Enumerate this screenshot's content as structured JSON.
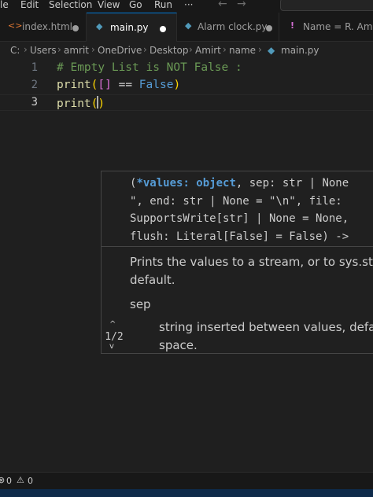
{
  "menubar": {
    "items": [
      "le",
      "Edit",
      "Selection",
      "View",
      "Go",
      "Run",
      "···"
    ],
    "back_arrow": "←",
    "forward_arrow": "→"
  },
  "tabs": [
    {
      "icon": "html-file-icon",
      "glyph": "<>",
      "label": "index.html",
      "modified": true,
      "active": false
    },
    {
      "icon": "python-file-icon",
      "glyph": "◆",
      "label": "main.py",
      "modified": true,
      "active": true
    },
    {
      "icon": "python-file-icon",
      "glyph": "◆",
      "label": "Alarm clock.py",
      "modified": true,
      "active": false
    },
    {
      "icon": "warning-icon",
      "glyph": "!",
      "label": "Name = R. Amrit",
      "modified": false,
      "active": false
    }
  ],
  "breadcrumb": [
    "C:",
    "Users",
    "amrit",
    "OneDrive",
    "Desktop",
    "Amirt",
    "name",
    "main.py"
  ],
  "editor": {
    "line_numbers": [
      "1",
      "2",
      "3"
    ],
    "line1": "# Empty List is NOT False :",
    "line2": {
      "func": "print",
      "open": "(",
      "list": "[]",
      "op": " == ",
      "kw": "False",
      "close": ")"
    },
    "line3": {
      "func": "print",
      "open": "(",
      "close": ")"
    }
  },
  "hover": {
    "signature": {
      "open": "(",
      "param": "*values: object",
      "line1_rest": ", sep: str | None",
      "line2": "\", end: str | None = \"\\n\", file:",
      "line3": "SupportsWrite[str] | None = None,",
      "line4": "flush: Literal[False] = False) ->"
    },
    "doc_line1": "Prints the values to a stream, or to sys.std",
    "doc_line2": "default.",
    "param_name": "sep",
    "param_desc1": "string inserted between values, defau",
    "param_desc2": "space.",
    "pager": "1/2",
    "up": "^",
    "down": "v"
  },
  "status": {
    "errors_icon": "⊗",
    "errors": "0",
    "warnings_icon": "⚠",
    "warnings": "0"
  },
  "colors": {
    "accent": "#0078d4",
    "editor_bg": "#1f1f1f",
    "keyword": "#569cd6",
    "function": "#dcdcaa",
    "comment": "#6a9955"
  }
}
